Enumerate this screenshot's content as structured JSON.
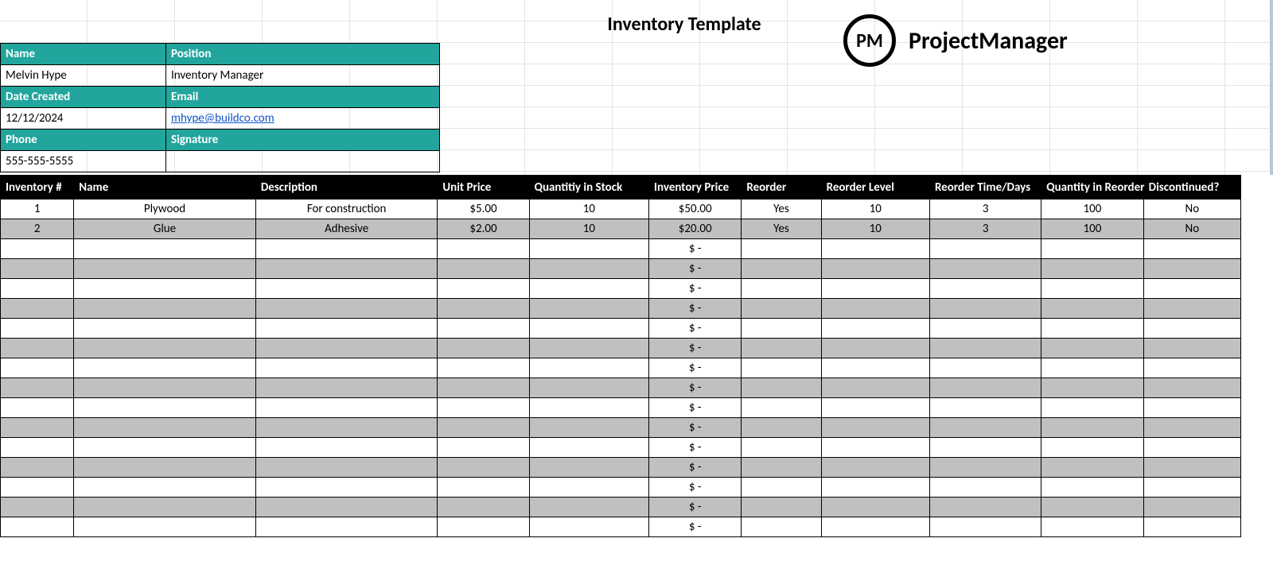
{
  "title": "Inventory Template",
  "brand": {
    "badge": "PM",
    "name": "ProjectManager"
  },
  "meta": {
    "labels": {
      "name": "Name",
      "position": "Position",
      "date_created": "Date Created",
      "email": "Email",
      "phone": "Phone",
      "signature": "Signature"
    },
    "name": "Melvin Hype",
    "position": "Inventory Manager",
    "date_created": "12/12/2024",
    "email": "mhype@buildco.com",
    "phone": "555-555-5555",
    "signature": ""
  },
  "inventory": {
    "headers": {
      "inv_no": "Inventory #",
      "name": "Name",
      "description": "Description",
      "unit_price": "Unit Price",
      "qty_stock": "Quantitiy in Stock",
      "inv_price": "Inventory Price",
      "reorder": "Reorder",
      "reorder_level": "Reorder Level",
      "reorder_days": "Reorder Time/Days",
      "reorder_qty": "Quantity in Reorder",
      "discontinued": "Discontinued?"
    },
    "rows": [
      {
        "inv_no": "1",
        "name": "Plywood",
        "description": "For construction",
        "unit_price": "$5.00",
        "qty_stock": "10",
        "inv_price": "$50.00",
        "reorder": "Yes",
        "reorder_level": "10",
        "reorder_days": "3",
        "reorder_qty": "100",
        "discontinued": "No"
      },
      {
        "inv_no": "2",
        "name": "Glue",
        "description": "Adhesive",
        "unit_price": "$2.00",
        "qty_stock": "10",
        "inv_price": "$20.00",
        "reorder": "Yes",
        "reorder_level": "10",
        "reorder_days": "3",
        "reorder_qty": "100",
        "discontinued": "No"
      }
    ],
    "empty_row_count": 15,
    "empty_inv_price_placeholder": "$ -"
  }
}
